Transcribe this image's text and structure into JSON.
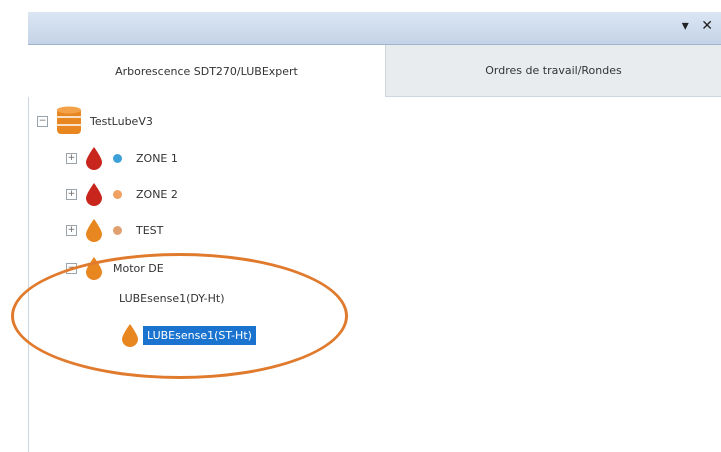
{
  "window": {
    "controls": "▾ ✕"
  },
  "tabs": [
    {
      "label": "Arborescence SDT270/LUBExpert",
      "active": true
    },
    {
      "label": "Ordres de travail/Rondes",
      "active": false
    }
  ],
  "tree": {
    "root": {
      "label": "TestLubeV3",
      "expander": "−",
      "icon": "database-icon"
    },
    "nodes": [
      {
        "label": "ZONE 1",
        "expander": "+",
        "drop_color": "#c8261d",
        "dot_color": "#3ea0d8"
      },
      {
        "label": "ZONE 2",
        "expander": "+",
        "drop_color": "#c8261d",
        "dot_color": "#f0a060"
      },
      {
        "label": "TEST",
        "expander": "+",
        "drop_color": "#e8861f",
        "dot_color": "#e0a070"
      },
      {
        "label": "Motor DE",
        "expander": "−",
        "drop_color": "#e8861f"
      }
    ],
    "children": [
      {
        "label": "LUBEsense1(DY-Ht)"
      },
      {
        "label": "LUBEsense1(ST-Ht)",
        "selected": true,
        "drop_color": "#e8861f"
      }
    ]
  },
  "colors": {
    "highlight": "#1a74cf",
    "annotation": "#e07a2c"
  }
}
